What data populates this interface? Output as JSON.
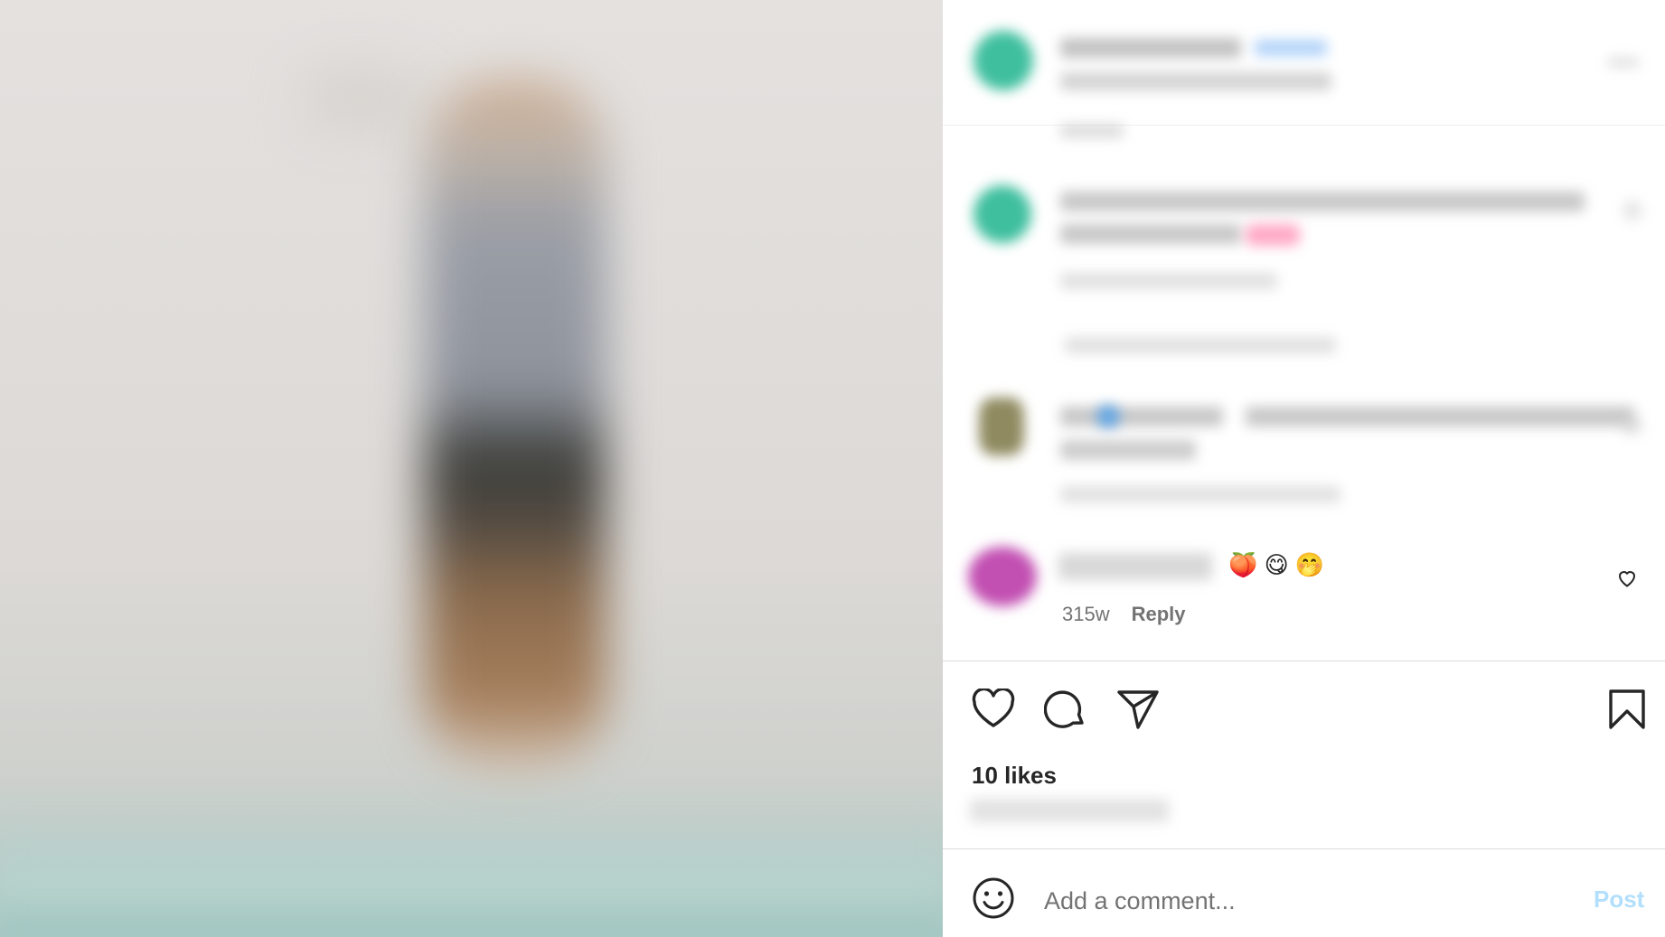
{
  "comments": [
    {
      "emojis": "🍑 😋 🤭",
      "timestamp": "315w",
      "reply_label": "Reply"
    }
  ],
  "actions": {
    "likes_text": "10 likes"
  },
  "composer": {
    "placeholder": "Add a comment...",
    "post_label": "Post"
  },
  "colors": {
    "accent_post": "#b2dffc",
    "verified": "#3897f0"
  },
  "icons": [
    "heart-icon",
    "comment-icon",
    "share-icon",
    "bookmark-icon",
    "emoji-icon",
    "more-icon"
  ]
}
